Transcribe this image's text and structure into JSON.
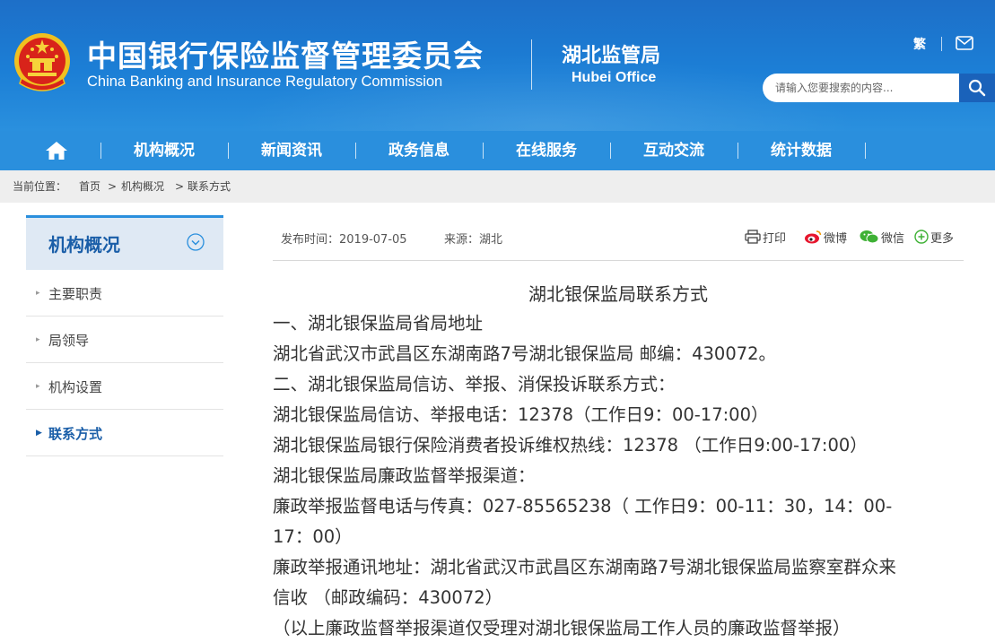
{
  "header": {
    "title_cn": "中国银行保险监督管理委员会",
    "title_en": "China Banking and Insurance Regulatory Commission",
    "office_cn": "湖北监管局",
    "office_en": "Hubei Office",
    "traditional_link": "繁",
    "mail_icon": "mail-icon",
    "search_placeholder": "请输入您要搜索的内容...",
    "search_icon": "search-icon",
    "emblem": "national-emblem"
  },
  "nav": {
    "home_icon": "home-icon",
    "items": [
      "机构概况",
      "新闻资讯",
      "政务信息",
      "在线服务",
      "互动交流",
      "统计数据"
    ]
  },
  "breadcrumb": {
    "prefix": "当前位置：",
    "items": [
      "首页",
      "机构概况",
      "联系方式"
    ],
    "separator": ">"
  },
  "sidebar": {
    "title": "机构概况",
    "toggle_icon": "chevron-down-circle-icon",
    "items": [
      {
        "label": "主要职责",
        "active": false
      },
      {
        "label": "局领导",
        "active": false
      },
      {
        "label": "机构设置",
        "active": false
      },
      {
        "label": "联系方式",
        "active": true
      }
    ]
  },
  "article": {
    "publish_time": "发布时间：2019-07-05",
    "source": "来源：湖北",
    "share": {
      "print": "打印",
      "weibo": "微博",
      "wechat": "微信",
      "more": "更多"
    },
    "title": "湖北银保监局联系方式",
    "lines": [
      "一、湖北银保监局省局地址",
      "湖北省武汉市武昌区东湖南路7号湖北银保监局 邮编：430072。",
      "二、湖北银保监局信访、举报、消保投诉联系方式：",
      "湖北银保监局信访、举报电话：12378（工作日9：00-17:00）",
      "湖北银保监局银行保险消费者投诉维权热线：12378 （工作日9:00-17:00）",
      "湖北银保监局廉政监督举报渠道：",
      "廉政举报监督电话与传真：027-85565238（ 工作日9：00-11：30，14：00-",
      "17：00）",
      "廉政举报通讯地址：湖北省武汉市武昌区东湖南路7号湖北银保监局监察室群众来",
      "信收 （邮政编码：430072）",
      "（以上廉政监督举报渠道仅受理对湖北银保监局工作人员的廉政监督举报）"
    ]
  },
  "colors": {
    "header_blue": "#1c7fd6",
    "nav_blue": "#2a8fdd",
    "sidebar_accent": "#1a5ea8",
    "breadcrumb_bg": "#eeeeee"
  }
}
